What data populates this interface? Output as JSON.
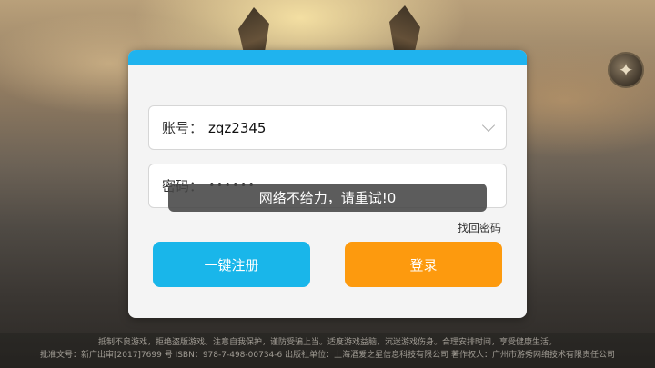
{
  "background": {
    "theme": "fantasy-sky-scene"
  },
  "corner_button": {
    "icon": "game-emblem-icon"
  },
  "login_form": {
    "account": {
      "label": "账号：",
      "value": "zqz2345"
    },
    "password": {
      "label": "密码：",
      "value": "••••••"
    },
    "forgot_link": "找回密码",
    "register_button": "一键注册",
    "login_button": "登录",
    "header_color": "#1fb3ee"
  },
  "toast": {
    "message": "网络不给力，请重试!0"
  },
  "footer": {
    "line1": "抵制不良游戏，拒绝盗版游戏。注意自我保护，谨防受骗上当。适度游戏益脑，沉迷游戏伤身。合理安排时间，享受健康生活。",
    "line2": "批准文号：新广出审[2017]7699 号    ISBN：978-7-498-00734-6    出版社单位：上海酒爱之星信息科技有限公司    著作权人：广州市游秀网络技术有限责任公司"
  }
}
